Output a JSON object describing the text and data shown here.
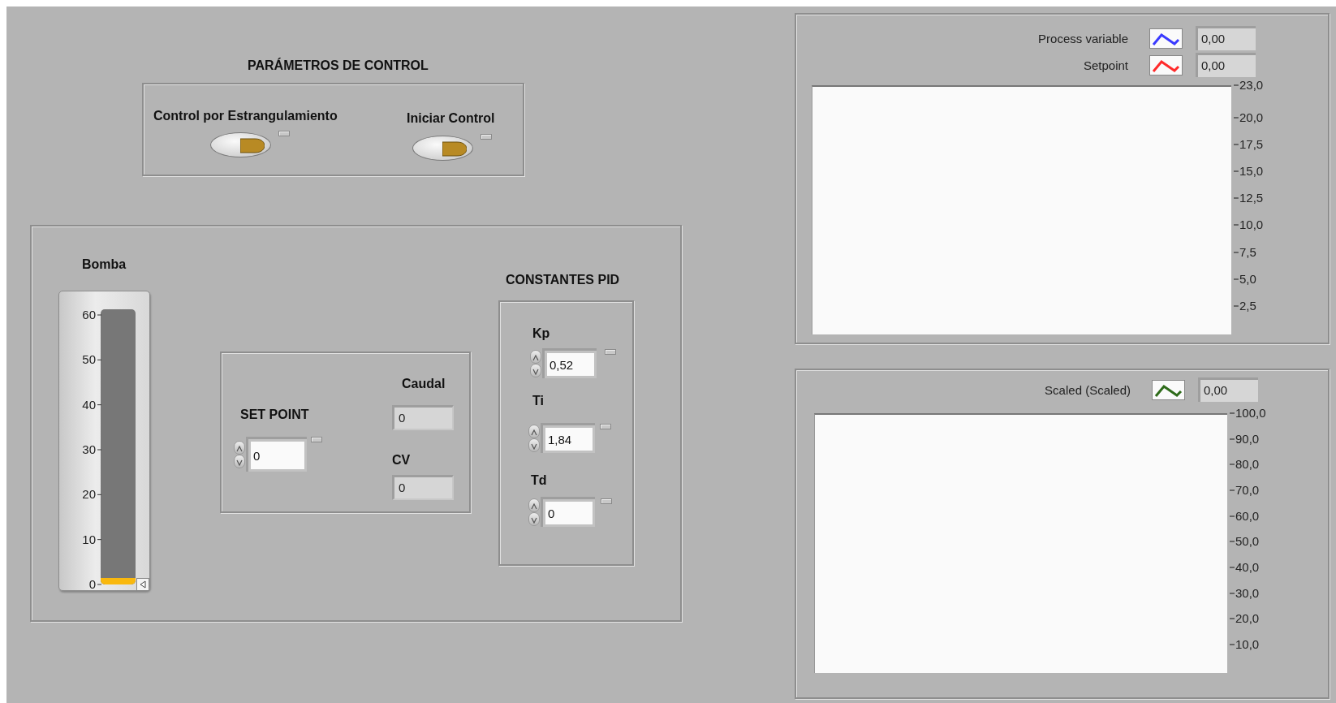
{
  "control_panel": {
    "title": "PARÁMETROS DE CONTROL",
    "toggles": [
      {
        "label": "Control por Estrangulamiento",
        "on": false
      },
      {
        "label": "Iniciar Control",
        "on": false
      }
    ]
  },
  "pump": {
    "label": "Bomba",
    "level": 0,
    "scale": [
      "60",
      "50",
      "40",
      "30",
      "20",
      "10",
      "0"
    ]
  },
  "setpoint": {
    "label": "SET POINT",
    "value": "0"
  },
  "indicators": [
    {
      "label": "Caudal",
      "value": "0"
    },
    {
      "label": "CV",
      "value": "0"
    }
  ],
  "pid": {
    "title": "CONSTANTES PID",
    "constants": [
      {
        "label": "Kp",
        "value": "0,52"
      },
      {
        "label": "Ti",
        "value": "1,84"
      },
      {
        "label": "Td",
        "value": "0"
      }
    ]
  },
  "charts": [
    {
      "legend": [
        {
          "label": "Process variable",
          "color": "#3a3aff",
          "reading": "0,00"
        },
        {
          "label": "Setpoint",
          "color": "#ff2a2a",
          "reading": "0,00"
        }
      ],
      "axis_labels": [
        "23,0",
        "20,0",
        "17,5",
        "15,0",
        "12,5",
        "10,0",
        "7,5",
        "5,0",
        "2,5"
      ]
    },
    {
      "legend": [
        {
          "label": "Scaled (Scaled)",
          "color": "#2e6b1a",
          "reading": "0,00"
        }
      ],
      "axis_labels": [
        "100,0",
        "90,0",
        "80,0",
        "70,0",
        "60,0",
        "50,0",
        "40,0",
        "30,0",
        "20,0",
        "10,0"
      ]
    }
  ]
}
